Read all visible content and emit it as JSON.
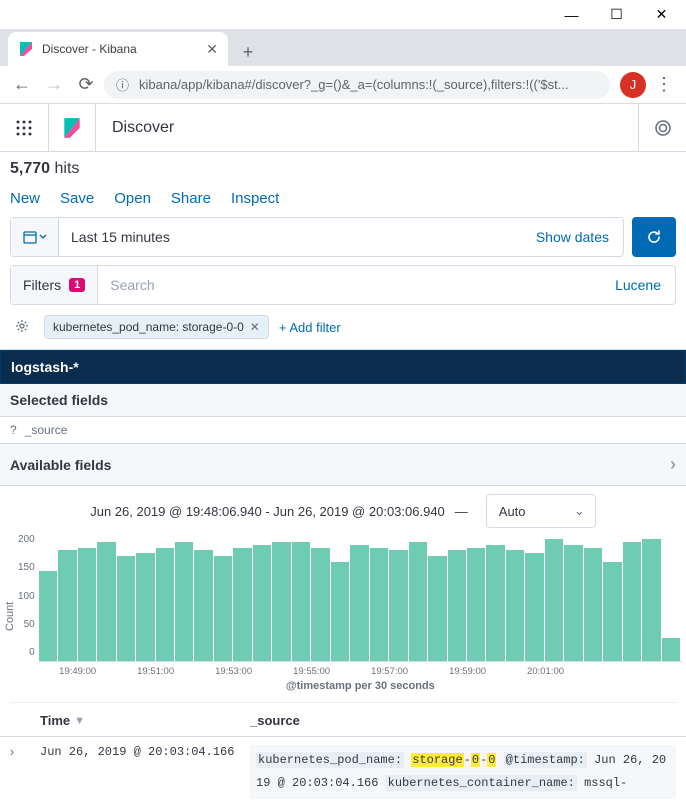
{
  "browser": {
    "tab_title": "Discover - Kibana",
    "url": "kibana/app/kibana#/discover?_g=()&_a=(columns:!(_source),filters:!(('$st...",
    "avatar_letter": "J"
  },
  "header": {
    "app_name": "Discover"
  },
  "hits": {
    "count": "5,770",
    "label": "hits"
  },
  "actions": {
    "new": "New",
    "save": "Save",
    "open": "Open",
    "share": "Share",
    "inspect": "Inspect"
  },
  "datepicker": {
    "range": "Last 15 minutes",
    "show_dates": "Show dates"
  },
  "search": {
    "filters_label": "Filters",
    "badge": "1",
    "placeholder": "Search",
    "lang": "Lucene"
  },
  "filters": {
    "pill": "kubernetes_pod_name: storage-0-0",
    "add": "+ Add filter"
  },
  "index_pattern": "logstash-*",
  "fields": {
    "selected_header": "Selected fields",
    "selected": "_source",
    "available_header": "Available fields"
  },
  "chart_data": {
    "type": "bar",
    "title_range": "Jun 26, 2019 @ 19:48:06.940 - Jun 26, 2019 @ 20:03:06.940",
    "interval": "Auto",
    "ylabel": "Count",
    "xlabel": "@timestamp per 30 seconds",
    "ylim": [
      0,
      220
    ],
    "y_ticks": [
      "200",
      "150",
      "100",
      "50",
      "0"
    ],
    "x_ticks": [
      "19:49:00",
      "19:51:00",
      "19:53:00",
      "19:55:00",
      "19:57:00",
      "19:59:00",
      "20:01:00"
    ],
    "categories": [
      "19:48:00",
      "19:48:30",
      "19:49:00",
      "19:49:30",
      "19:50:00",
      "19:50:30",
      "19:51:00",
      "19:51:30",
      "19:52:00",
      "19:52:30",
      "19:53:00",
      "19:53:30",
      "19:54:00",
      "19:54:30",
      "19:55:00",
      "19:55:30",
      "19:56:00",
      "19:56:30",
      "19:57:00",
      "19:57:30",
      "19:58:00",
      "19:58:30",
      "19:59:00",
      "19:59:30",
      "20:00:00",
      "20:00:30",
      "20:01:00",
      "20:01:30",
      "20:02:00",
      "20:02:30",
      "20:03:00"
    ],
    "values": [
      155,
      190,
      195,
      205,
      180,
      185,
      195,
      205,
      190,
      180,
      195,
      200,
      205,
      205,
      195,
      170,
      200,
      195,
      190,
      205,
      180,
      190,
      195,
      200,
      190,
      185,
      210,
      200,
      195,
      170,
      205,
      210,
      40
    ]
  },
  "table": {
    "col_time": "Time",
    "col_source": "_source",
    "rows": [
      {
        "time": "Jun 26, 2019 @ 20:03:04.166",
        "source": {
          "k1": "kubernetes_pod_name:",
          "v1_a": "storage",
          "v1_b": "0",
          "v1_c": "0",
          "k2": "@timestamp:",
          "v2": "Jun 26, 2019 @ 20:03:04.166",
          "k3": "kubernetes_container_name:",
          "v3": "mssql-"
        }
      }
    ]
  }
}
